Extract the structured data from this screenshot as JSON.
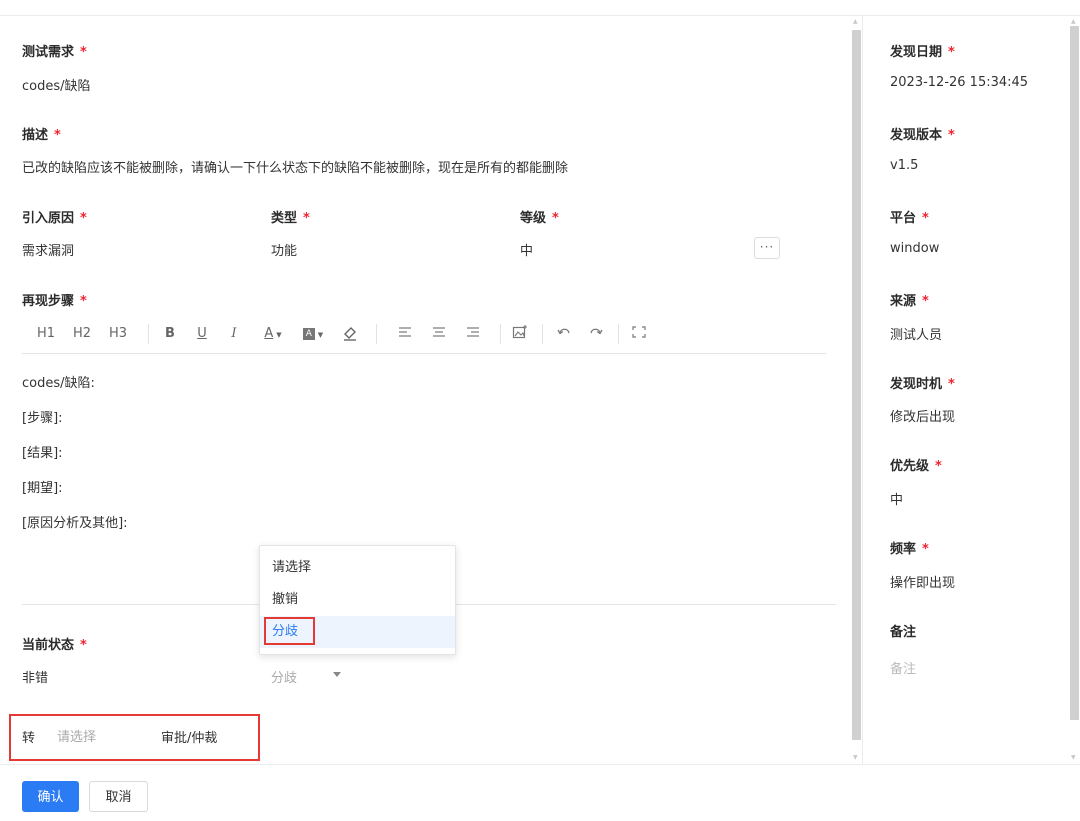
{
  "fields": {
    "test_req": {
      "label": "测试需求",
      "value": "codes/缺陷"
    },
    "desc": {
      "label": "描述",
      "value": "已改的缺陷应该不能被删除，请确认一下什么状态下的缺陷不能被删除，现在是所有的都能删除"
    },
    "cause": {
      "label": "引入原因",
      "value": "需求漏洞"
    },
    "type": {
      "label": "类型",
      "value": "功能"
    },
    "level": {
      "label": "等级",
      "value": "中"
    },
    "steps": {
      "label": "再现步骤"
    },
    "status": {
      "label": "当前状态",
      "value": "非错"
    }
  },
  "required_mark": "*",
  "more_button": "···",
  "toolbar": {
    "h1": "H1",
    "h2": "H2",
    "h3": "H3",
    "bold": "B",
    "underline": "U",
    "italic": "I",
    "font_color": "A",
    "bg_color": "A"
  },
  "editor": {
    "lines": [
      "codes/缺陷:",
      "[步骤]:",
      "[结果]:",
      "[期望]:",
      "[原因分析及其他]:"
    ]
  },
  "dropdown": {
    "options": [
      "请选择",
      "撤销",
      "分歧"
    ],
    "selected": "分歧"
  },
  "transfer": {
    "label": "转",
    "placeholder": "请选择",
    "action": "审批/仲裁"
  },
  "side": {
    "found_date": {
      "label": "发现日期",
      "value": "2023-12-26 15:34:45"
    },
    "found_version": {
      "label": "发现版本",
      "value": "v1.5"
    },
    "platform": {
      "label": "平台",
      "value": "window"
    },
    "source": {
      "label": "来源",
      "value": "测试人员"
    },
    "found_timing": {
      "label": "发现时机",
      "value": "修改后出现"
    },
    "priority": {
      "label": "优先级",
      "value": "中"
    },
    "frequency": {
      "label": "频率",
      "value": "操作即出现"
    },
    "remark": {
      "label": "备注",
      "placeholder": "备注"
    }
  },
  "buttons": {
    "confirm": "确认",
    "cancel": "取消"
  },
  "colors": {
    "primary": "#2a7bf4",
    "required": "#f5222d",
    "highlight_box": "#e53935"
  }
}
